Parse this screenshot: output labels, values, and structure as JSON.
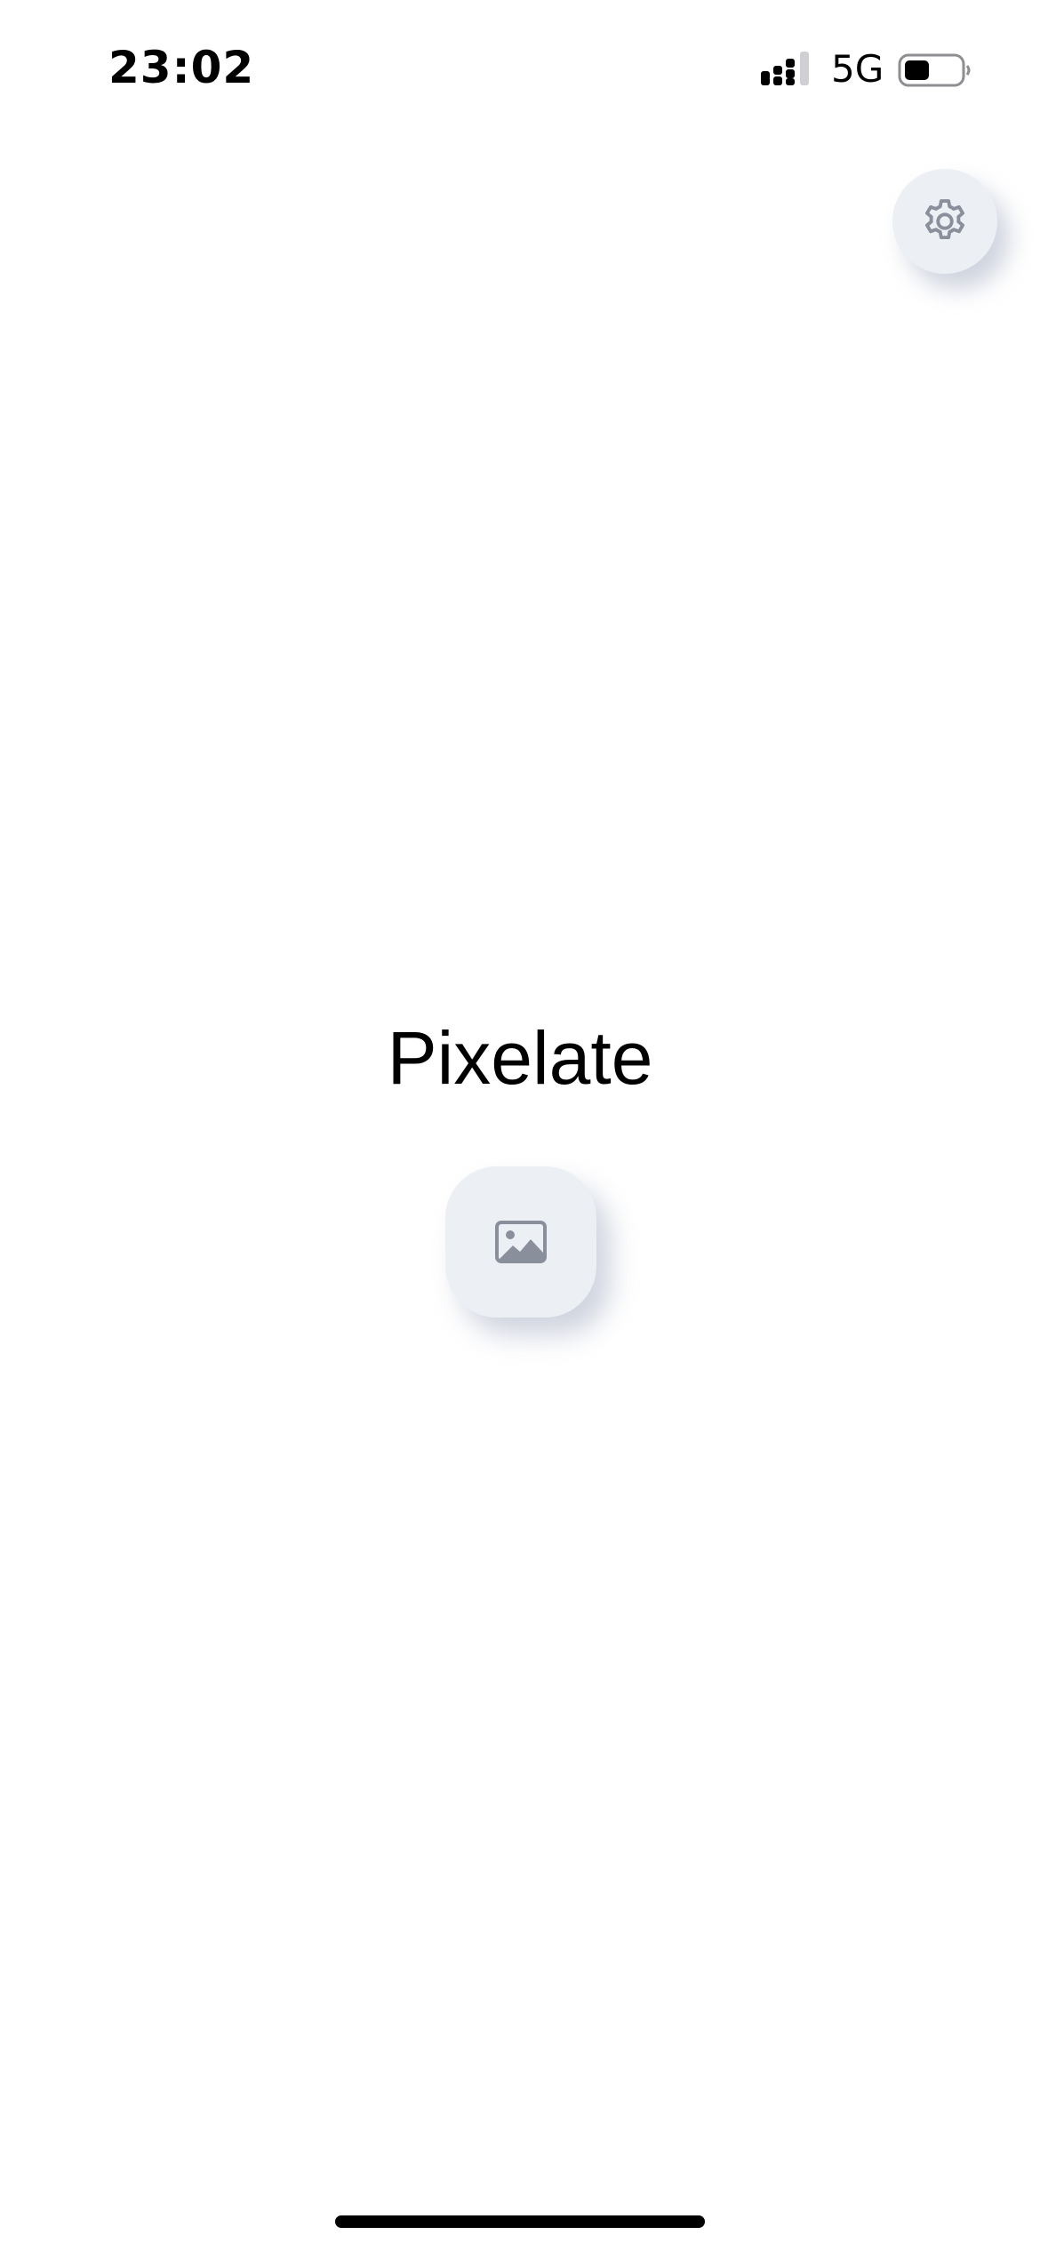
{
  "status_bar": {
    "time": "23:02",
    "network": "5G",
    "signal_icon": "signal-bars-icon",
    "battery_icon": "battery-icon",
    "battery_level": 0.45
  },
  "header": {
    "settings_icon": "gear-icon"
  },
  "main": {
    "title": "Pixelate",
    "image_button_icon": "photo-icon"
  },
  "colors": {
    "background": "#ffffff",
    "button_surface": "#eceff3",
    "icon_gray": "#8a8f9c",
    "text": "#000000"
  }
}
